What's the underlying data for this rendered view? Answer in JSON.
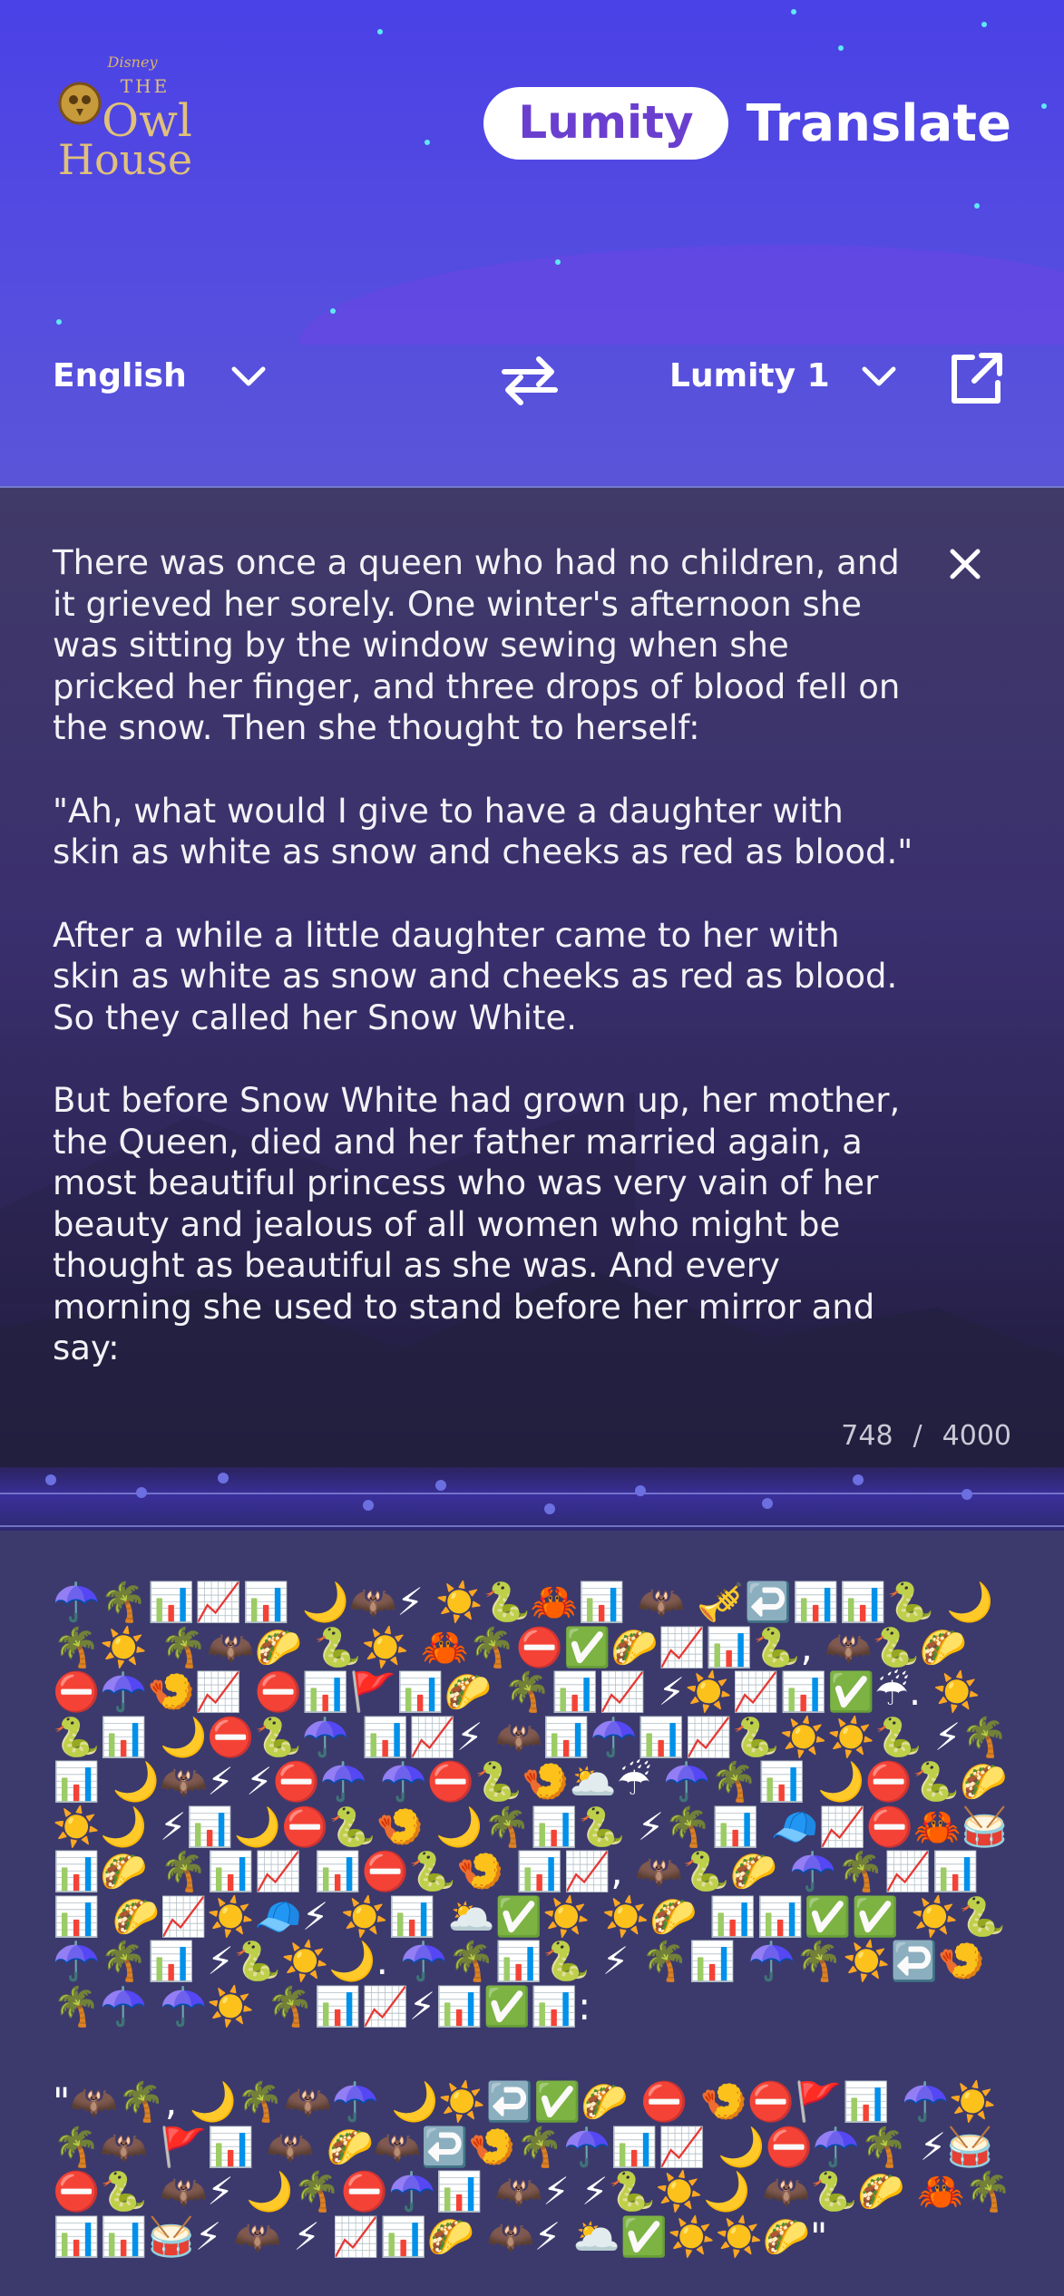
{
  "header": {
    "logo": {
      "brand": "Disney",
      "line1": "THE",
      "line2": "Owl",
      "line3": "House"
    },
    "title_pill": "Lumity",
    "title_word": "Translate",
    "accent_color": "#6a3fcf"
  },
  "language_bar": {
    "source_language": "English",
    "target_language": "Lumity 1",
    "icons": {
      "source_dropdown": "chevron-down-icon",
      "swap": "swap-arrows-icon",
      "target_dropdown": "chevron-down-icon",
      "open": "external-link-icon"
    }
  },
  "input": {
    "paragraphs": [
      "There was once a queen who had no children, and it grieved her sorely. One winter's afternoon she was sitting by the window sewing when she pricked her finger, and three drops of blood fell on the snow. Then she thought to herself:",
      "\"Ah, what would I give to have a daughter with skin as white as snow and cheeks as red as blood.\"",
      "After a while a little daughter came to her with skin as white as snow and cheeks as red as blood. So they called her Snow White.",
      "But before Snow White had grown up, her mother, the Queen, died and her father married again, a most beautiful princess who was very vain of her beauty and jealous of all women who might be thought as beautiful as she was. And every morning she used to stand before her mirror and say:"
    ],
    "clear_icon": "close-icon",
    "char_count": "748",
    "separator": "/",
    "char_limit": "4000"
  },
  "output": {
    "paragraphs": [
      "☂️🌴📊📈📊 🌙🦇⚡ ☀️🐍🦀📊 🦇 🎺↩️📊📊🐍 🌙🌴☀️ 🌴🦇🌮 🐍☀️ 🦀🌴⛔✅🌮📈📊🐍, 🦇🐍🌮 ⛔☂️🍤📈 ⛔📊🚩📊🌮 🌴📊📈 ⚡☀️📈📊✅☔. ☀️🐍📊 🌙⛔🐍☂️ 📊📈⚡ 🦇📊☂️📊📈🐍☀️☀️🐍 ⚡🌴📊 🌙🦇⚡ ⚡⛔☂️ ☂️⛔🐍🍤🌥️☔ ☂️🌴📊 🌙⛔🐍🌮☀️🌙 ⚡📊🌙⛔🐍🍤 🌙🌴📊🐍 ⚡🌴📊 🧢📈⛔🦀🥁📊🌮 🌴📊📈 📊⛔🐍🍤 📊📈, 🦇🐍🌮 ☂️🌴📈📊📊 🌮📈☀️🧢⚡ ☀️📊 🌥️✅☀️ ☀️🌮 📊📊✅✅ ☀️🐍 ☂️🌴📊 ⚡🐍☀️🌙. ☂️🌴📊🐍 ⚡ 🌴📊 ☂️🌴☀️↩️🍤🌴☂️ ☂️☀️ 🌴📊📈⚡📊✅📊:",
      "\"🦇🌴, 🌙🌴🦇☂️ 🌙☀️↩️✅🌮 ⛔ 🍤⛔🚩📊 ☂️☀️ 🌴🦇 🚩📊 🦇 🌮🦇↩️🍤🌴☂️📊📈 🌙⛔☂️🌴 ⚡🥁⛔🐍 🦇⚡ 🌙🌴⛔☂️📊 🦇⚡ ⚡🐍☀️🌙 🦇🐍🌮 🦀🌴📊📊🥁⚡ 🦇 ⚡ 📈📊🌮 🦇⚡ 🌥️✅☀️☀️🌮\""
    ]
  }
}
